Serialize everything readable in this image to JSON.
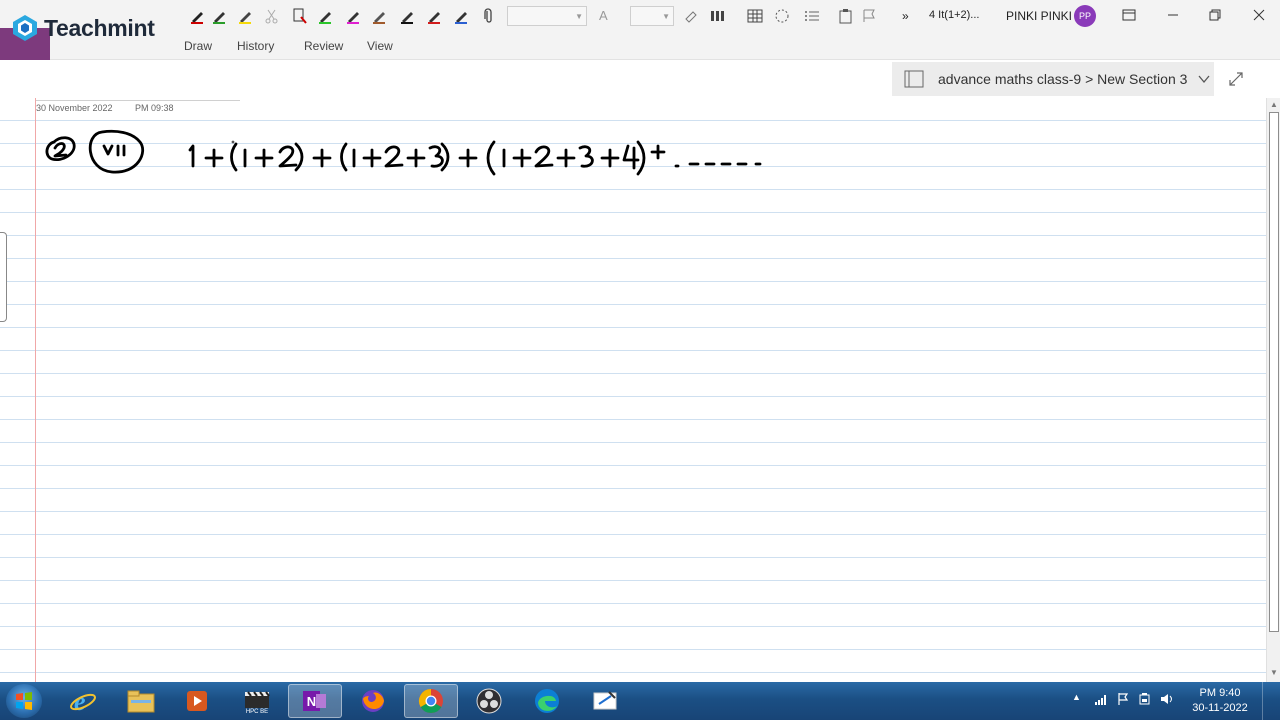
{
  "brand": {
    "name": "Teachmint"
  },
  "toolbar": {
    "open_window_label": "4 It(1+2)...",
    "user_name": "PINKI PINKI",
    "user_initials": "PP",
    "overflow_label": "»"
  },
  "ribbon": {
    "tabs": [
      "Draw",
      "History",
      "Review",
      "View"
    ]
  },
  "notebook": {
    "path": "advance maths class-9 > New Section 3"
  },
  "page": {
    "date": "30 November 2022",
    "time": "PM 09:38",
    "handwriting": {
      "question_number": "2",
      "part_label": "v ii",
      "expression": "1 + (1+2) + (1+2+3) + (1+2+3+4) + ------"
    }
  },
  "taskbar": {
    "apps": [
      "internet-explorer",
      "file-explorer",
      "media-player",
      "video-editor",
      "onenote",
      "firefox",
      "chrome",
      "obs",
      "edge",
      "whiteboard"
    ],
    "video_editor_label": "HPC BE",
    "onenote_label": "N",
    "active_app": "onenote",
    "clock_time": "PM 9:40",
    "clock_date": "30-11-2022"
  },
  "colors": {
    "onenote_purple": "#7d3a7d",
    "page_rule": "#cfe0f0",
    "margin_red": "#f0a7a7",
    "taskbar_blue": "#1b4f84",
    "avatar": "#8a3ab9"
  }
}
